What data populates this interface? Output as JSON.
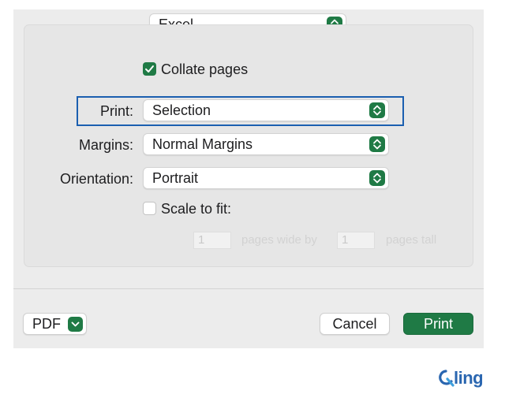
{
  "printer_app": {
    "value": "Excel"
  },
  "options": {
    "collate": {
      "label": "Collate pages",
      "checked": true
    },
    "print": {
      "label": "Print:",
      "value": "Selection"
    },
    "margins": {
      "label": "Margins:",
      "value": "Normal Margins"
    },
    "orientation": {
      "label": "Orientation:",
      "value": "Portrait"
    },
    "scale_to_fit": {
      "label": "Scale to fit:",
      "checked": false,
      "pages_wide_value": "1",
      "pages_wide_text": "pages wide by",
      "pages_tall_value": "1",
      "pages_tall_text": "pages tall"
    }
  },
  "footer": {
    "pdf_label": "PDF",
    "cancel_label": "Cancel",
    "print_label": "Print"
  },
  "watermark": {
    "text": "ling"
  },
  "colors": {
    "accent": "#1f7a45",
    "focus": "#1b5fb0",
    "logo": "#2a66b0"
  },
  "icons": [
    "updown-chevron-icon",
    "checkmark-icon",
    "chevron-down-icon",
    "qling-logo-icon"
  ]
}
